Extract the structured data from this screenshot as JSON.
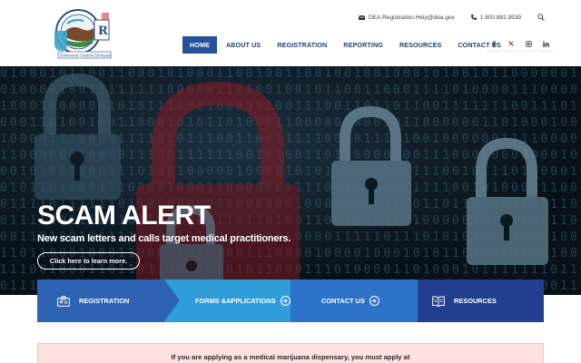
{
  "header": {
    "logo_text": "Diversion Control Division",
    "email": "DEA.Registration.Help@dea.gov",
    "phone": "1.800.882.9539",
    "nav": [
      {
        "label": "HOME",
        "active": true
      },
      {
        "label": "ABOUT US",
        "active": false
      },
      {
        "label": "REGISTRATION",
        "active": false
      },
      {
        "label": "REPORTING",
        "active": false
      },
      {
        "label": "RESOURCES",
        "active": false
      },
      {
        "label": "CONTACT US",
        "active": false
      }
    ],
    "social": [
      "facebook-icon",
      "x-icon",
      "instagram-icon",
      "linkedin-icon"
    ]
  },
  "hero": {
    "title": "SCAM ALERT",
    "subtitle": "New scam letters and calls target medical practitioners.",
    "button": "Click here to learn more."
  },
  "quick_links": [
    {
      "label": "REGISTRATION",
      "icon": "id-card-icon"
    },
    {
      "label": "FORMS &APPLICATIONS",
      "icon": "arrow-circle-icon"
    },
    {
      "label": "CONTACT US",
      "icon": "arrow-circle-icon"
    },
    {
      "label": "RESOURCES",
      "icon": "book-icon"
    }
  ],
  "notice": {
    "text": "If you are applying as a medical marijuana dispensary, you must apply at"
  },
  "colors": {
    "nav_active": "#24519a",
    "registration": "#2e63b4",
    "forms": "#2f9dd8",
    "contact": "#2c73c9",
    "resources": "#213f8e",
    "notice_bg": "#fde1e1"
  }
}
